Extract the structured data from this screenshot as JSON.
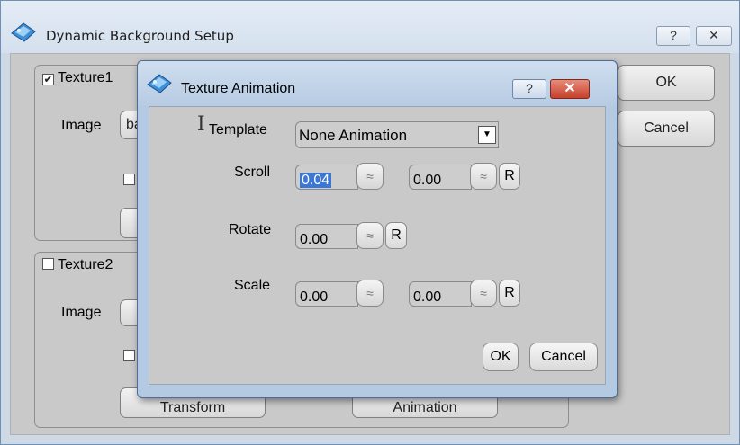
{
  "main": {
    "title": "Dynamic Background Setup",
    "help_glyph": "?",
    "close_glyph": "✕",
    "ok_label": "OK",
    "cancel_label": "Cancel",
    "texture1": {
      "label": "Texture1",
      "checked": true,
      "check_glyph": "✔",
      "image_label": "Image",
      "image_value": "ba"
    },
    "texture2": {
      "label": "Texture2",
      "checked": false,
      "image_label": "Image",
      "transform_label": "Transform",
      "animation_label": "Animation"
    }
  },
  "anim": {
    "title": "Texture Animation",
    "help_glyph": "?",
    "close_glyph": "✕",
    "template_label": "Template",
    "template_value": "None Animation",
    "dropdown_glyph": "▼",
    "spin_glyph": "≈",
    "reset_label": "R",
    "scroll_label": "Scroll",
    "scroll_x": "0.04",
    "scroll_y": "0.00",
    "rotate_label": "Rotate",
    "rotate_value": "0.00",
    "scale_label": "Scale",
    "scale_x": "0.00",
    "scale_y": "0.00",
    "ok_label": "OK",
    "cancel_label": "Cancel"
  },
  "colors": {
    "accent": "#3b78d6",
    "close": "#c7402a",
    "frame": "#b4c9e2"
  }
}
